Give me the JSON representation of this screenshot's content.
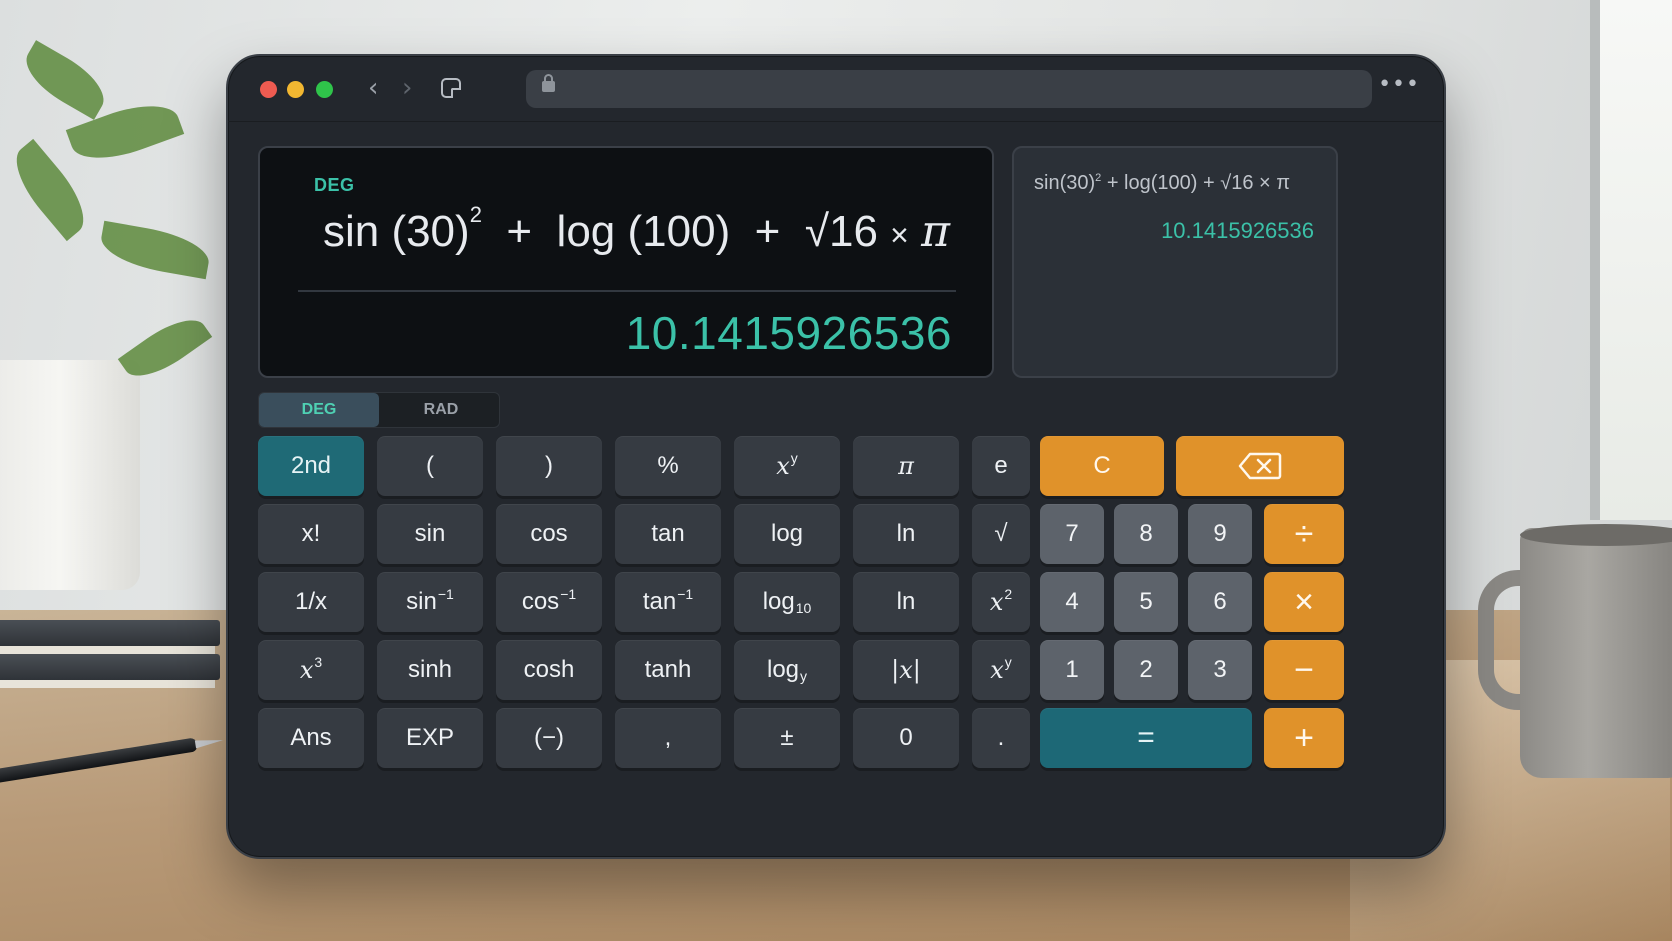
{
  "window": {
    "url": ""
  },
  "display": {
    "mode": "DEG",
    "expression": {
      "sin": "sin",
      "sin_arg": "(30)",
      "sin_exp": "2",
      "plus1": "+",
      "log": "log",
      "log_arg": "(100)",
      "plus2": "+",
      "root": "√16",
      "times": "×",
      "pi": "π"
    },
    "result": "10.1415926536"
  },
  "history": {
    "expr_a": "sin(30)",
    "expr_exp": "2",
    "expr_b": " + log(100) + √16 × π",
    "result": "10.1415926536"
  },
  "angle_toggle": {
    "deg": "DEG",
    "rad": "RAD",
    "selected": "DEG"
  },
  "keys": {
    "second": "2nd",
    "lparen": "(",
    "rparen": ")",
    "percent": "%",
    "pow_base": "x",
    "pow_exp": "y",
    "pi": "π",
    "e": "e",
    "clear": "C",
    "fact": "x!",
    "sin": "sin",
    "cos": "cos",
    "tan": "tan",
    "log": "log",
    "ln": "ln",
    "sqrt": "√",
    "seven": "7",
    "eight": "8",
    "nine": "9",
    "divide": "÷",
    "recip": "1/x",
    "asin": "sin",
    "acos": "cos",
    "atan": "tan",
    "inv_exp": "−1",
    "log10": "log",
    "log10_sub": "10",
    "ln2": "ln",
    "sq_base": "x",
    "sq_exp": "2",
    "four": "4",
    "five": "5",
    "six": "6",
    "multiply": "×",
    "cube_base": "x",
    "cube_exp": "3",
    "sinh": "sinh",
    "cosh": "cosh",
    "tanh": "tanh",
    "logy": "log",
    "logy_sub": "y",
    "abs": "|x|",
    "xy_base": "x",
    "xy_exp": "y",
    "one": "1",
    "two": "2",
    "three": "3",
    "minus": "−",
    "ans": "Ans",
    "exp": "EXP",
    "neg": "(−)",
    "comma": ",",
    "plusminus": "±",
    "zero": "0",
    "dot": ".",
    "equals": "=",
    "plus": "+"
  },
  "colors": {
    "accent_teal": "#3bc1a8",
    "operator_orange": "#e0922a",
    "equals_teal": "#1d6876"
  }
}
